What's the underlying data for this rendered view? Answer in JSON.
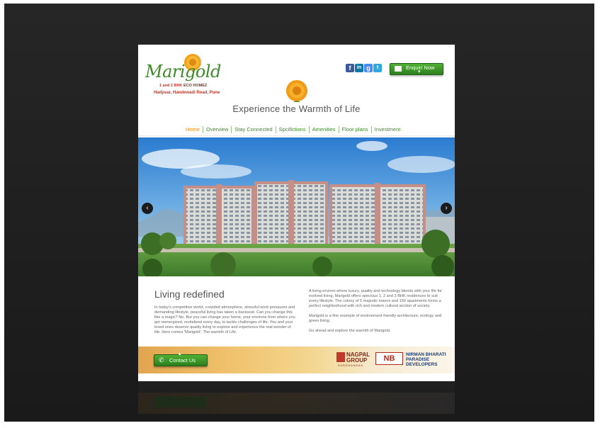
{
  "brand": {
    "name": "Marigold",
    "bhk": "1 and 2 BHK",
    "eco": "ECO HOMEZ",
    "location": "Hadpsar, Handewadi Road, Pune"
  },
  "header": {
    "social_icons": [
      "facebook-icon",
      "linkedin-icon",
      "googleplus-icon",
      "twitter-icon"
    ],
    "enquiry_label": "Enquiri Now",
    "tagline": "Experience the Warmth of Life"
  },
  "nav": {
    "items": [
      "Home",
      "Overview",
      "Stay Connected",
      "Spcifictions",
      "Amenities",
      "Floor plans",
      "Investment"
    ]
  },
  "slider": {
    "prev_label": "‹",
    "next_label": "›"
  },
  "content": {
    "title": "Living redefined",
    "left_text": "In today's competitive world, crowded atmosphere, stressful work pressures and demanding lifestyle, peaceful living has taken a backseat. Can you change this like a magic? No. But you can change your home, your environs from where you get reenergized, revitalized every day, to tackle challenges of life. You and your loved ones deserve quality living to explore and experience the real wonder of life.  Here comes 'Marigold', The warmth of Life.",
    "right_p1": "A living environ where luxury, quality and technology blends with your life for evolved living. Marigold offers specious 1, 2 and 3 BHK residences to suit every lifestyle. The colony of 5 majestic towers and 150 apartments forms a perfect neighborhood with rich and modern cultural section of society.",
    "right_p2": "Marigold is a fine example of environment friendly architecture, ecology and green living.",
    "right_p3": "Go ahead and explore the warmth of Marigold."
  },
  "footer": {
    "contact_label": "Contact Us",
    "nagpal_name_1": "NAGPAL",
    "nagpal_name_2": "GROUP",
    "nagpal_sub": "SURENDARAS",
    "nb_logo_text": "NB",
    "nb_name_1": "NIRMAN BHARATI",
    "nb_name_2": "PARADISE",
    "nb_name_3": "DEVELOPERS"
  },
  "colors": {
    "green": "#3f8a2b",
    "orange": "#f08a1c",
    "button_green": "#2d7f1e",
    "frame": "#1c1c1c"
  }
}
